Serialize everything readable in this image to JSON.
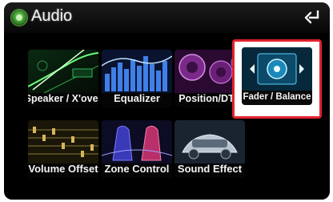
{
  "header": {
    "title": "Audio",
    "app_icon": "audio-app-icon",
    "back_icon": "return-arrow-icon"
  },
  "menu": {
    "items": [
      {
        "label": "Speaker / X'over"
      },
      {
        "label": "Equalizer"
      },
      {
        "label": "Position/DTA"
      },
      {
        "label": "Fader / Balance",
        "highlighted": true
      },
      {
        "label": "Volume Offset"
      },
      {
        "label": "Zone Control"
      },
      {
        "label": "Sound Effect"
      }
    ]
  },
  "colors": {
    "highlight_border": "#e0222e",
    "screen_bg": "#000000",
    "text": "#f2f2f2"
  }
}
